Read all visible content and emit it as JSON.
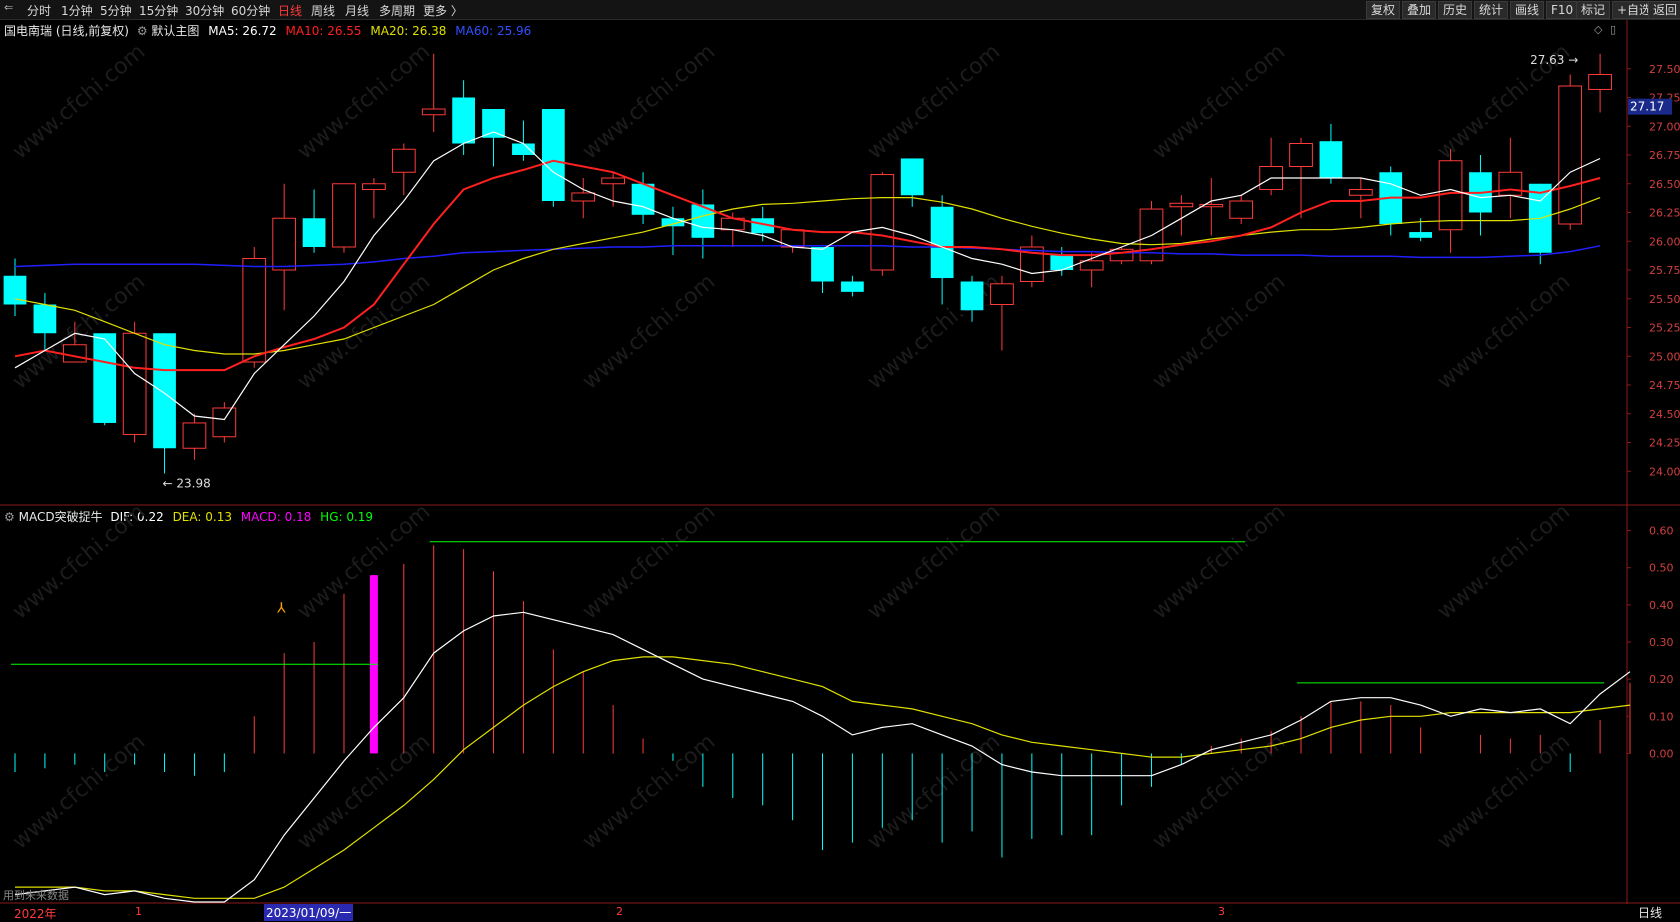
{
  "toolbar": {
    "back_icon": "back-arrow-icon",
    "periods": [
      "分时",
      "1分钟",
      "5分钟",
      "15分钟",
      "30分钟",
      "60分钟",
      "日线",
      "周线",
      "月线",
      "多周期",
      "更多 〉"
    ],
    "active_period": "日线",
    "right_buttons": [
      "复权",
      "叠加",
      "历史",
      "统计",
      "画线",
      "F10",
      "标记",
      "+自选",
      "返回"
    ]
  },
  "main_info": {
    "title": "国电南瑞 (日线,前复权)",
    "template": "默认主图",
    "ma5": "MA5: 26.72",
    "ma10": "MA10: 26.55",
    "ma20": "MA20: 26.38",
    "ma60": "MA60: 25.96"
  },
  "colors": {
    "up": "#ff3b3b",
    "down": "#00ffff",
    "ma5": "#ffffff",
    "ma10": "#ff2020",
    "ma20": "#e0e000",
    "ma60": "#2020ff",
    "dif": "#ffffff",
    "dea": "#e0e000",
    "macd_highlight": "#ff00ff",
    "hg": "#00ff00"
  },
  "price_axis": {
    "labels": [
      "27.50",
      "27.25",
      "27.00",
      "26.75",
      "26.50",
      "26.25",
      "26.00",
      "25.75",
      "25.50",
      "25.25",
      "25.00",
      "24.75",
      "24.50",
      "24.25",
      "24.00"
    ],
    "current_price": "27.17",
    "high_label": "27.63",
    "low_label": "23.98"
  },
  "chart_data": {
    "type": "candlestick",
    "candles": [
      {
        "o": 25.7,
        "h": 25.85,
        "c": 25.45,
        "l": 25.35
      },
      {
        "o": 25.45,
        "h": 25.55,
        "c": 25.2,
        "l": 25.05
      },
      {
        "o": 24.95,
        "h": 25.3,
        "c": 25.1,
        "l": 24.95
      },
      {
        "o": 25.2,
        "h": 25.2,
        "c": 24.42,
        "l": 24.4
      },
      {
        "o": 24.32,
        "h": 25.3,
        "c": 25.2,
        "l": 24.25
      },
      {
        "o": 25.2,
        "h": 25.2,
        "c": 24.2,
        "l": 23.98
      },
      {
        "o": 24.2,
        "h": 24.5,
        "c": 24.42,
        "l": 24.1
      },
      {
        "o": 24.3,
        "h": 24.6,
        "c": 24.55,
        "l": 24.25
      },
      {
        "o": 24.95,
        "h": 25.95,
        "c": 25.85,
        "l": 24.9
      },
      {
        "o": 25.75,
        "h": 26.5,
        "c": 26.2,
        "l": 25.4
      },
      {
        "o": 26.2,
        "h": 26.45,
        "c": 25.95,
        "l": 25.9
      },
      {
        "o": 25.95,
        "h": 26.5,
        "c": 26.5,
        "l": 25.9
      },
      {
        "o": 26.45,
        "h": 26.55,
        "c": 26.5,
        "l": 26.2
      },
      {
        "o": 26.6,
        "h": 26.85,
        "c": 26.8,
        "l": 26.4
      },
      {
        "o": 27.1,
        "h": 27.63,
        "c": 27.15,
        "l": 26.95
      },
      {
        "o": 27.25,
        "h": 27.4,
        "c": 26.85,
        "l": 26.75
      },
      {
        "o": 27.15,
        "h": 27.15,
        "c": 26.9,
        "l": 26.65
      },
      {
        "o": 26.85,
        "h": 27.05,
        "c": 26.75,
        "l": 26.7
      },
      {
        "o": 27.15,
        "h": 27.15,
        "c": 26.35,
        "l": 26.3
      },
      {
        "o": 26.35,
        "h": 26.55,
        "c": 26.42,
        "l": 26.2
      },
      {
        "o": 26.5,
        "h": 26.6,
        "c": 26.55,
        "l": 26.3
      },
      {
        "o": 26.5,
        "h": 26.6,
        "c": 26.23,
        "l": 26.15
      },
      {
        "o": 26.2,
        "h": 26.3,
        "c": 26.13,
        "l": 25.88
      },
      {
        "o": 26.32,
        "h": 26.45,
        "c": 26.03,
        "l": 25.85
      },
      {
        "o": 26.1,
        "h": 26.25,
        "c": 26.2,
        "l": 25.95
      },
      {
        "o": 26.2,
        "h": 26.3,
        "c": 26.07,
        "l": 26.0
      },
      {
        "o": 25.95,
        "h": 26.1,
        "c": 26.1,
        "l": 25.9
      },
      {
        "o": 25.95,
        "h": 25.95,
        "c": 25.65,
        "l": 25.55
      },
      {
        "o": 25.65,
        "h": 25.7,
        "c": 25.56,
        "l": 25.52
      },
      {
        "o": 25.75,
        "h": 26.6,
        "c": 26.58,
        "l": 25.7
      },
      {
        "o": 26.72,
        "h": 26.72,
        "c": 26.4,
        "l": 26.3
      },
      {
        "o": 26.3,
        "h": 26.4,
        "c": 25.68,
        "l": 25.45
      },
      {
        "o": 25.65,
        "h": 25.7,
        "c": 25.4,
        "l": 25.3
      },
      {
        "o": 25.45,
        "h": 25.7,
        "c": 25.63,
        "l": 25.05
      },
      {
        "o": 25.65,
        "h": 26.05,
        "c": 25.95,
        "l": 25.6
      },
      {
        "o": 25.88,
        "h": 25.95,
        "c": 25.75,
        "l": 25.7
      },
      {
        "o": 25.75,
        "h": 25.9,
        "c": 25.83,
        "l": 25.6
      },
      {
        "o": 25.83,
        "h": 25.95,
        "c": 25.93,
        "l": 25.8
      },
      {
        "o": 25.83,
        "h": 26.35,
        "c": 26.28,
        "l": 25.8
      },
      {
        "o": 26.3,
        "h": 26.4,
        "c": 26.33,
        "l": 26.05
      },
      {
        "o": 26.3,
        "h": 26.55,
        "c": 26.32,
        "l": 26.05
      },
      {
        "o": 26.2,
        "h": 26.4,
        "c": 26.35,
        "l": 26.15
      },
      {
        "o": 26.45,
        "h": 26.9,
        "c": 26.65,
        "l": 26.4
      },
      {
        "o": 26.65,
        "h": 26.9,
        "c": 26.85,
        "l": 26.2
      },
      {
        "o": 26.87,
        "h": 27.02,
        "c": 26.55,
        "l": 26.5
      },
      {
        "o": 26.4,
        "h": 26.55,
        "c": 26.45,
        "l": 26.2
      },
      {
        "o": 26.6,
        "h": 26.65,
        "c": 26.15,
        "l": 26.05
      },
      {
        "o": 26.08,
        "h": 26.2,
        "c": 26.03,
        "l": 26.0
      },
      {
        "o": 26.1,
        "h": 26.8,
        "c": 26.7,
        "l": 25.9
      },
      {
        "o": 26.6,
        "h": 26.75,
        "c": 26.25,
        "l": 26.05
      },
      {
        "o": 26.4,
        "h": 26.9,
        "c": 26.6,
        "l": 26.2
      },
      {
        "o": 26.5,
        "h": 26.5,
        "c": 25.9,
        "l": 25.8
      },
      {
        "o": 26.15,
        "h": 27.45,
        "c": 27.35,
        "l": 26.1
      },
      {
        "o": 27.32,
        "h": 27.63,
        "c": 27.45,
        "l": 27.12
      }
    ],
    "ma5": [
      24.9,
      25.05,
      25.2,
      25.15,
      24.85,
      24.68,
      24.48,
      24.45,
      24.85,
      25.1,
      25.35,
      25.65,
      26.05,
      26.35,
      26.7,
      26.85,
      26.95,
      26.85,
      26.6,
      26.45,
      26.35,
      26.3,
      26.2,
      26.12,
      26.1,
      26.05,
      25.95,
      25.93,
      26.08,
      26.12,
      26.05,
      25.95,
      25.85,
      25.8,
      25.72,
      25.75,
      25.85,
      25.95,
      26.05,
      26.2,
      26.35,
      26.4,
      26.55,
      26.55,
      26.55,
      26.55,
      26.5,
      26.4,
      26.45,
      26.38,
      26.4,
      26.35,
      26.6,
      26.72
    ],
    "ma10": [
      25.0,
      25.05,
      25.0,
      24.95,
      24.9,
      24.88,
      24.88,
      24.88,
      25.0,
      25.08,
      25.15,
      25.25,
      25.45,
      25.8,
      26.15,
      26.45,
      26.55,
      26.62,
      26.7,
      26.65,
      26.6,
      26.5,
      26.4,
      26.3,
      26.2,
      26.15,
      26.1,
      26.08,
      26.08,
      26.05,
      26.0,
      25.95,
      25.95,
      25.93,
      25.9,
      25.88,
      25.88,
      25.9,
      25.93,
      25.97,
      26.0,
      26.05,
      26.12,
      26.25,
      26.35,
      26.35,
      26.38,
      26.38,
      26.42,
      26.42,
      26.45,
      26.42,
      26.48,
      26.55
    ],
    "ma20": [
      25.5,
      25.45,
      25.4,
      25.3,
      25.2,
      25.1,
      25.05,
      25.02,
      25.02,
      25.05,
      25.1,
      25.15,
      25.25,
      25.35,
      25.45,
      25.6,
      25.75,
      25.85,
      25.93,
      25.98,
      26.03,
      26.08,
      26.15,
      26.22,
      26.28,
      26.32,
      26.33,
      26.35,
      26.37,
      26.38,
      26.38,
      26.34,
      26.28,
      26.2,
      26.13,
      26.07,
      26.02,
      25.98,
      25.97,
      25.98,
      26.02,
      26.05,
      26.08,
      26.1,
      26.1,
      26.12,
      26.15,
      26.17,
      26.18,
      26.18,
      26.18,
      26.2,
      26.28,
      26.38
    ],
    "ma60": [
      25.78,
      25.79,
      25.8,
      25.8,
      25.8,
      25.8,
      25.8,
      25.79,
      25.78,
      25.78,
      25.79,
      25.8,
      25.82,
      25.85,
      25.87,
      25.9,
      25.91,
      25.92,
      25.93,
      25.94,
      25.95,
      25.95,
      25.96,
      25.96,
      25.96,
      25.96,
      25.96,
      25.96,
      25.96,
      25.96,
      25.95,
      25.95,
      25.94,
      25.93,
      25.92,
      25.91,
      25.91,
      25.9,
      25.9,
      25.89,
      25.89,
      25.88,
      25.88,
      25.88,
      25.87,
      25.87,
      25.87,
      25.86,
      25.86,
      25.86,
      25.87,
      25.88,
      25.91,
      25.96
    ],
    "macd": {
      "dif": [
        -0.38,
        -0.37,
        -0.36,
        -0.38,
        -0.37,
        -0.39,
        -0.4,
        -0.4,
        -0.34,
        -0.22,
        -0.12,
        -0.02,
        0.07,
        0.15,
        0.27,
        0.33,
        0.37,
        0.38,
        0.36,
        0.34,
        0.32,
        0.28,
        0.24,
        0.2,
        0.18,
        0.16,
        0.14,
        0.1,
        0.05,
        0.07,
        0.08,
        0.05,
        0.02,
        -0.03,
        -0.05,
        -0.06,
        -0.06,
        -0.06,
        -0.06,
        -0.03,
        0.01,
        0.03,
        0.05,
        0.09,
        0.14,
        0.15,
        0.15,
        0.13,
        0.1,
        0.12,
        0.11,
        0.12,
        0.08,
        0.16,
        0.22
      ],
      "dea": [
        -0.36,
        -0.36,
        -0.36,
        -0.37,
        -0.37,
        -0.38,
        -0.39,
        -0.39,
        -0.39,
        -0.36,
        -0.31,
        -0.26,
        -0.2,
        -0.14,
        -0.07,
        0.01,
        0.07,
        0.13,
        0.18,
        0.22,
        0.25,
        0.26,
        0.26,
        0.25,
        0.24,
        0.22,
        0.2,
        0.18,
        0.14,
        0.13,
        0.12,
        0.1,
        0.08,
        0.05,
        0.03,
        0.02,
        0.01,
        0.0,
        -0.01,
        -0.01,
        0.0,
        0.01,
        0.02,
        0.04,
        0.07,
        0.09,
        0.1,
        0.1,
        0.11,
        0.11,
        0.11,
        0.11,
        0.11,
        0.12,
        0.13
      ],
      "hist": [
        -0.05,
        -0.04,
        -0.03,
        -0.05,
        -0.03,
        -0.05,
        -0.06,
        -0.05,
        0.1,
        0.27,
        0.3,
        0.43,
        0.48,
        0.51,
        0.56,
        0.55,
        0.49,
        0.41,
        0.28,
        0.22,
        0.13,
        0.04,
        -0.02,
        -0.09,
        -0.12,
        -0.14,
        -0.18,
        -0.26,
        -0.24,
        -0.2,
        -0.18,
        -0.24,
        -0.21,
        -0.28,
        -0.23,
        -0.22,
        -0.22,
        -0.14,
        -0.09,
        -0.03,
        0.02,
        0.04,
        0.06,
        0.1,
        0.14,
        0.14,
        0.13,
        0.07,
        0.0,
        0.05,
        0.04,
        0.05,
        -0.05,
        0.09,
        0.19
      ],
      "ylim": [
        -0.4,
        0.65
      ],
      "highlight_bar_index": 12,
      "hg_lines": [
        {
          "from": 0,
          "to": 12,
          "value": 0.24
        },
        {
          "from": 14,
          "to": 41,
          "value": 0.57
        },
        {
          "from": 43,
          "to": 53,
          "value": 0.19
        }
      ]
    },
    "price_ylim": [
      23.75,
      27.75
    ]
  },
  "macd_info": {
    "indicator": "MACD突破捉牛",
    "dif": "DIF: 0.22",
    "dea": "DEA: 0.13",
    "macd": "MACD: 0.18",
    "hg": "HG: 0.19"
  },
  "macd_axis": {
    "labels": [
      "0.60",
      "0.50",
      "0.40",
      "0.30",
      "0.20",
      "0.10",
      "0.00"
    ]
  },
  "bottom": {
    "note": "用到未来数据",
    "dates": [
      "2022年",
      "1",
      "2023/01/09/一",
      "2",
      "3"
    ],
    "period": "日线"
  },
  "watermark": "www.cfchi.com"
}
